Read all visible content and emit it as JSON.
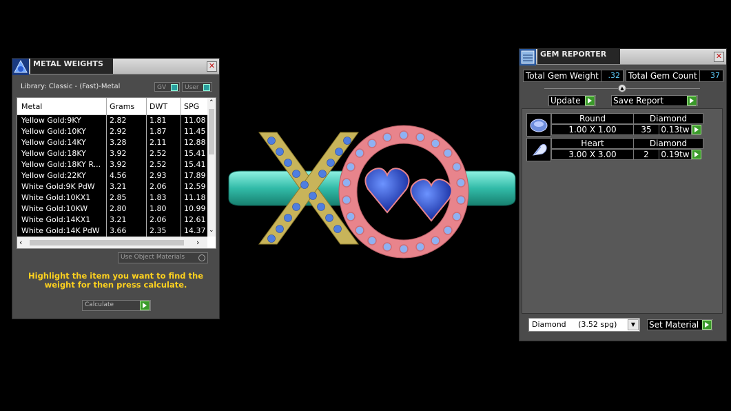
{
  "metal_weights": {
    "title": "METAL WEIGHTS",
    "library_label": "Library: Classic - (Fast)-Metal",
    "toggle_gv": "GV",
    "toggle_user": "User",
    "columns": [
      "Metal",
      "Grams",
      "DWT",
      "SPG"
    ],
    "rows": [
      {
        "metal": "Yellow Gold:9KY",
        "grams": "2.82",
        "dwt": "1.81",
        "spg": "11.08"
      },
      {
        "metal": "Yellow Gold:10KY",
        "grams": "2.92",
        "dwt": "1.87",
        "spg": "11.45"
      },
      {
        "metal": "Yellow Gold:14KY",
        "grams": "3.28",
        "dwt": "2.11",
        "spg": "12.88"
      },
      {
        "metal": "Yellow Gold:18KY",
        "grams": "3.92",
        "dwt": "2.52",
        "spg": "15.41"
      },
      {
        "metal": "Yellow Gold:18KY R...",
        "grams": "3.92",
        "dwt": "2.52",
        "spg": "15.41"
      },
      {
        "metal": "Yellow Gold:22KY",
        "grams": "4.56",
        "dwt": "2.93",
        "spg": "17.89"
      },
      {
        "metal": "White Gold:9K PdW",
        "grams": "3.21",
        "dwt": "2.06",
        "spg": "12.59"
      },
      {
        "metal": "White Gold:10KX1",
        "grams": "2.85",
        "dwt": "1.83",
        "spg": "11.18"
      },
      {
        "metal": "White Gold:10KW",
        "grams": "2.80",
        "dwt": "1.80",
        "spg": "10.99"
      },
      {
        "metal": "White Gold:14KX1",
        "grams": "3.21",
        "dwt": "2.06",
        "spg": "12.61"
      },
      {
        "metal": "White Gold:14K PdW",
        "grams": "3.66",
        "dwt": "2.35",
        "spg": "14.37"
      }
    ],
    "use_object_materials": "Use Object Materials",
    "hint": "Highlight the item you want to find the weight for then press calculate.",
    "calculate_label": "Calculate"
  },
  "gem_reporter": {
    "title": "GEM REPORTER",
    "total_weight_label": "Total Gem Weight",
    "total_weight_value": ".32",
    "total_count_label": "Total Gem Count",
    "total_count_value": "37",
    "update_label": "Update",
    "save_report_label": "Save Report",
    "gems": [
      {
        "shape": "Round",
        "material": "Diamond",
        "size": "1.00 X 1.00",
        "count": "35",
        "weight": "0.13tw",
        "icon": "round-gem-icon"
      },
      {
        "shape": "Heart",
        "material": "Diamond",
        "size": "3.00 X 3.00",
        "count": "2",
        "weight": "0.19tw",
        "icon": "heart-gem-icon"
      }
    ],
    "material_select": "Diamond     (3.52 spg)",
    "set_material_label": "Set Material"
  },
  "colors": {
    "yellow_gold": "#c8b45a",
    "rose_gold": "#e8848c",
    "shank": "#46d7c6",
    "stone_blue": "#3c6fd6",
    "hint_text": "#ffd21e"
  }
}
